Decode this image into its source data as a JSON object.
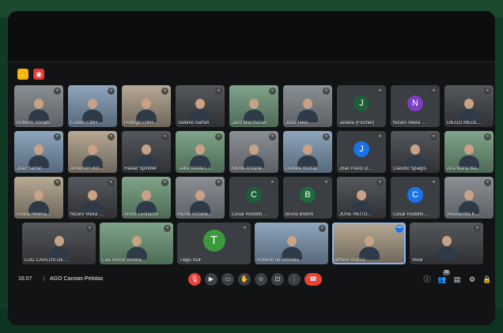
{
  "meeting": {
    "time": "16:07",
    "separator": "|",
    "name": "AGO Canoas-Pelotas",
    "participant_count": "39"
  },
  "colors": {
    "accent": "#1a73e8",
    "end_call": "#ea4335",
    "bezel": "#1b4a2f"
  },
  "top_buttons": [
    {
      "icon": "hand-raise-icon",
      "glyph": "✋"
    },
    {
      "icon": "record-icon",
      "glyph": "◉"
    }
  ],
  "tiles": [
    {
      "name": "Roberto Sonatti",
      "kind": "video",
      "icon": "mic-off-icon",
      "mic": "✕"
    },
    {
      "name": "Evaldo CIBH Ca...",
      "kind": "video",
      "icon": "mic-off-icon",
      "mic": "✕"
    },
    {
      "name": "Rodrigo CIBH Gu...",
      "kind": "video",
      "icon": "mic-off-icon",
      "mic": "✕"
    },
    {
      "name": "Solenio Sartori",
      "kind": "video",
      "icon": "mic-off-icon",
      "mic": "✕"
    },
    {
      "name": "Jairo Marchezan",
      "kind": "video",
      "icon": "mic-off-icon",
      "mic": "✕"
    },
    {
      "name": "Joao Teles",
      "kind": "video",
      "icon": "mic-off-icon",
      "mic": "✕"
    },
    {
      "name": "Juliana (Fischer)",
      "kind": "avatar",
      "letter": "J",
      "color": "#1e5e3a",
      "icon": "mic-off-icon",
      "mic": "✕"
    },
    {
      "name": "Nizaro Vieira Lima",
      "kind": "avatar",
      "letter": "N",
      "color": "#7b3fbf",
      "icon": "mic-off-icon",
      "mic": "✕"
    },
    {
      "name": "DIEGO MEDEIRO...",
      "kind": "video",
      "icon": "mic-off-icon",
      "mic": "✕"
    },
    {
      "name": "Joao Sartori",
      "kind": "video",
      "icon": "mic-off-icon",
      "mic": "✕"
    },
    {
      "name": "Anderson Borba ...",
      "kind": "video",
      "icon": "mic-off-icon",
      "mic": "✕"
    },
    {
      "name": "Rafael Spindler",
      "kind": "video",
      "icon": "mic-off-icon",
      "mic": "✕"
    },
    {
      "name": "Talita Varela Lima",
      "kind": "video",
      "icon": "mic-off-icon",
      "mic": "✕"
    },
    {
      "name": "Murilo Anzanello ...",
      "kind": "video",
      "icon": "mic-off-icon",
      "mic": "✕"
    },
    {
      "name": "Daniele Bistrap",
      "kind": "video",
      "icon": "mic-off-icon",
      "mic": "✕"
    },
    {
      "name": "João Paulo De Sá",
      "kind": "avatar",
      "letter": "J",
      "color": "#1a73e8",
      "icon": "mic-off-icon",
      "mic": "✕"
    },
    {
      "name": "Claudio Spaigis",
      "kind": "video",
      "icon": "mic-off-icon",
      "mic": "✕"
    },
    {
      "name": "Ana Maria Bianc...",
      "kind": "video",
      "icon": "mic-off-icon",
      "mic": "✕"
    },
    {
      "name": "Gisela Helena B...",
      "kind": "video",
      "icon": "mic-off-icon",
      "mic": "✕"
    },
    {
      "name": "Nizaro Vieira Lima",
      "kind": "video",
      "icon": "mic-off-icon",
      "mic": "✕"
    },
    {
      "name": "André Leonardo",
      "kind": "video",
      "icon": "mic-off-icon",
      "mic": "✕"
    },
    {
      "name": "Murilo Anzanello ...",
      "kind": "video",
      "icon": "mic-off-icon",
      "mic": "✕"
    },
    {
      "name": "César Rodolfo Se...",
      "kind": "avatar",
      "letter": "C",
      "color": "#1e5e3a",
      "icon": "mic-off-icon",
      "mic": "✕"
    },
    {
      "name": "Bruno Brehm",
      "kind": "avatar",
      "letter": "B",
      "color": "#1e6b3c",
      "icon": "mic-off-icon",
      "mic": "✕"
    },
    {
      "name": "JOSE HEITOR M...",
      "kind": "video",
      "icon": "mic-off-icon",
      "mic": "✕"
    },
    {
      "name": "Cesar Rodolfo S...",
      "kind": "avatar",
      "letter": "C",
      "color": "#1a73e8",
      "icon": "mic-off-icon",
      "mic": "✕"
    },
    {
      "name": "Alessandra Keidi...",
      "kind": "video",
      "icon": "mic-off-icon",
      "mic": "✕"
    },
    {
      "name": "LUIZ CARLOS DE ...",
      "kind": "video",
      "icon": "mic-off-icon",
      "mic": "✕"
    },
    {
      "name": "Laís Bruna Verona",
      "kind": "video",
      "icon": "mic-off-icon",
      "mic": "✕"
    },
    {
      "name": "Tiago SDF",
      "kind": "avatar",
      "letter": "T",
      "color": "#3c9a3c",
      "icon": "mic-off-icon",
      "mic": "✕"
    },
    {
      "name": "Roberto de Almeida",
      "kind": "video",
      "icon": "mic-off-icon",
      "mic": "✕"
    },
    {
      "name": "alfhere Branco",
      "kind": "video",
      "icon": "more-icon",
      "mic": "•••"
    },
    {
      "name": "Você",
      "kind": "video",
      "icon": "mic-off-icon",
      "mic": "✕"
    }
  ],
  "controls": [
    {
      "name": "mic-button",
      "icon": "mic-off-icon",
      "glyph": "🎙"
    },
    {
      "name": "camera-button",
      "icon": "camera-icon",
      "glyph": "▶"
    },
    {
      "name": "captions-button",
      "icon": "captions-icon",
      "glyph": "▭"
    },
    {
      "name": "raise-hand-button",
      "icon": "hand-icon",
      "glyph": "✋"
    },
    {
      "name": "emoji-button",
      "icon": "emoji-icon",
      "glyph": "☺"
    },
    {
      "name": "present-button",
      "icon": "present-icon",
      "glyph": "⊡"
    },
    {
      "name": "more-options-button",
      "icon": "more-vert-icon",
      "glyph": "⋮"
    },
    {
      "name": "end-call-button",
      "icon": "end-call-icon",
      "glyph": "☎"
    }
  ],
  "right_controls": [
    {
      "name": "info-button",
      "icon": "info-icon",
      "glyph": "ⓘ"
    },
    {
      "name": "people-button",
      "icon": "people-icon",
      "glyph": "👥"
    },
    {
      "name": "chat-button",
      "icon": "chat-icon",
      "glyph": "▤"
    },
    {
      "name": "activities-button",
      "icon": "activities-icon",
      "glyph": "⚙"
    },
    {
      "name": "lock-button",
      "icon": "lock-icon",
      "glyph": "🔒"
    }
  ]
}
